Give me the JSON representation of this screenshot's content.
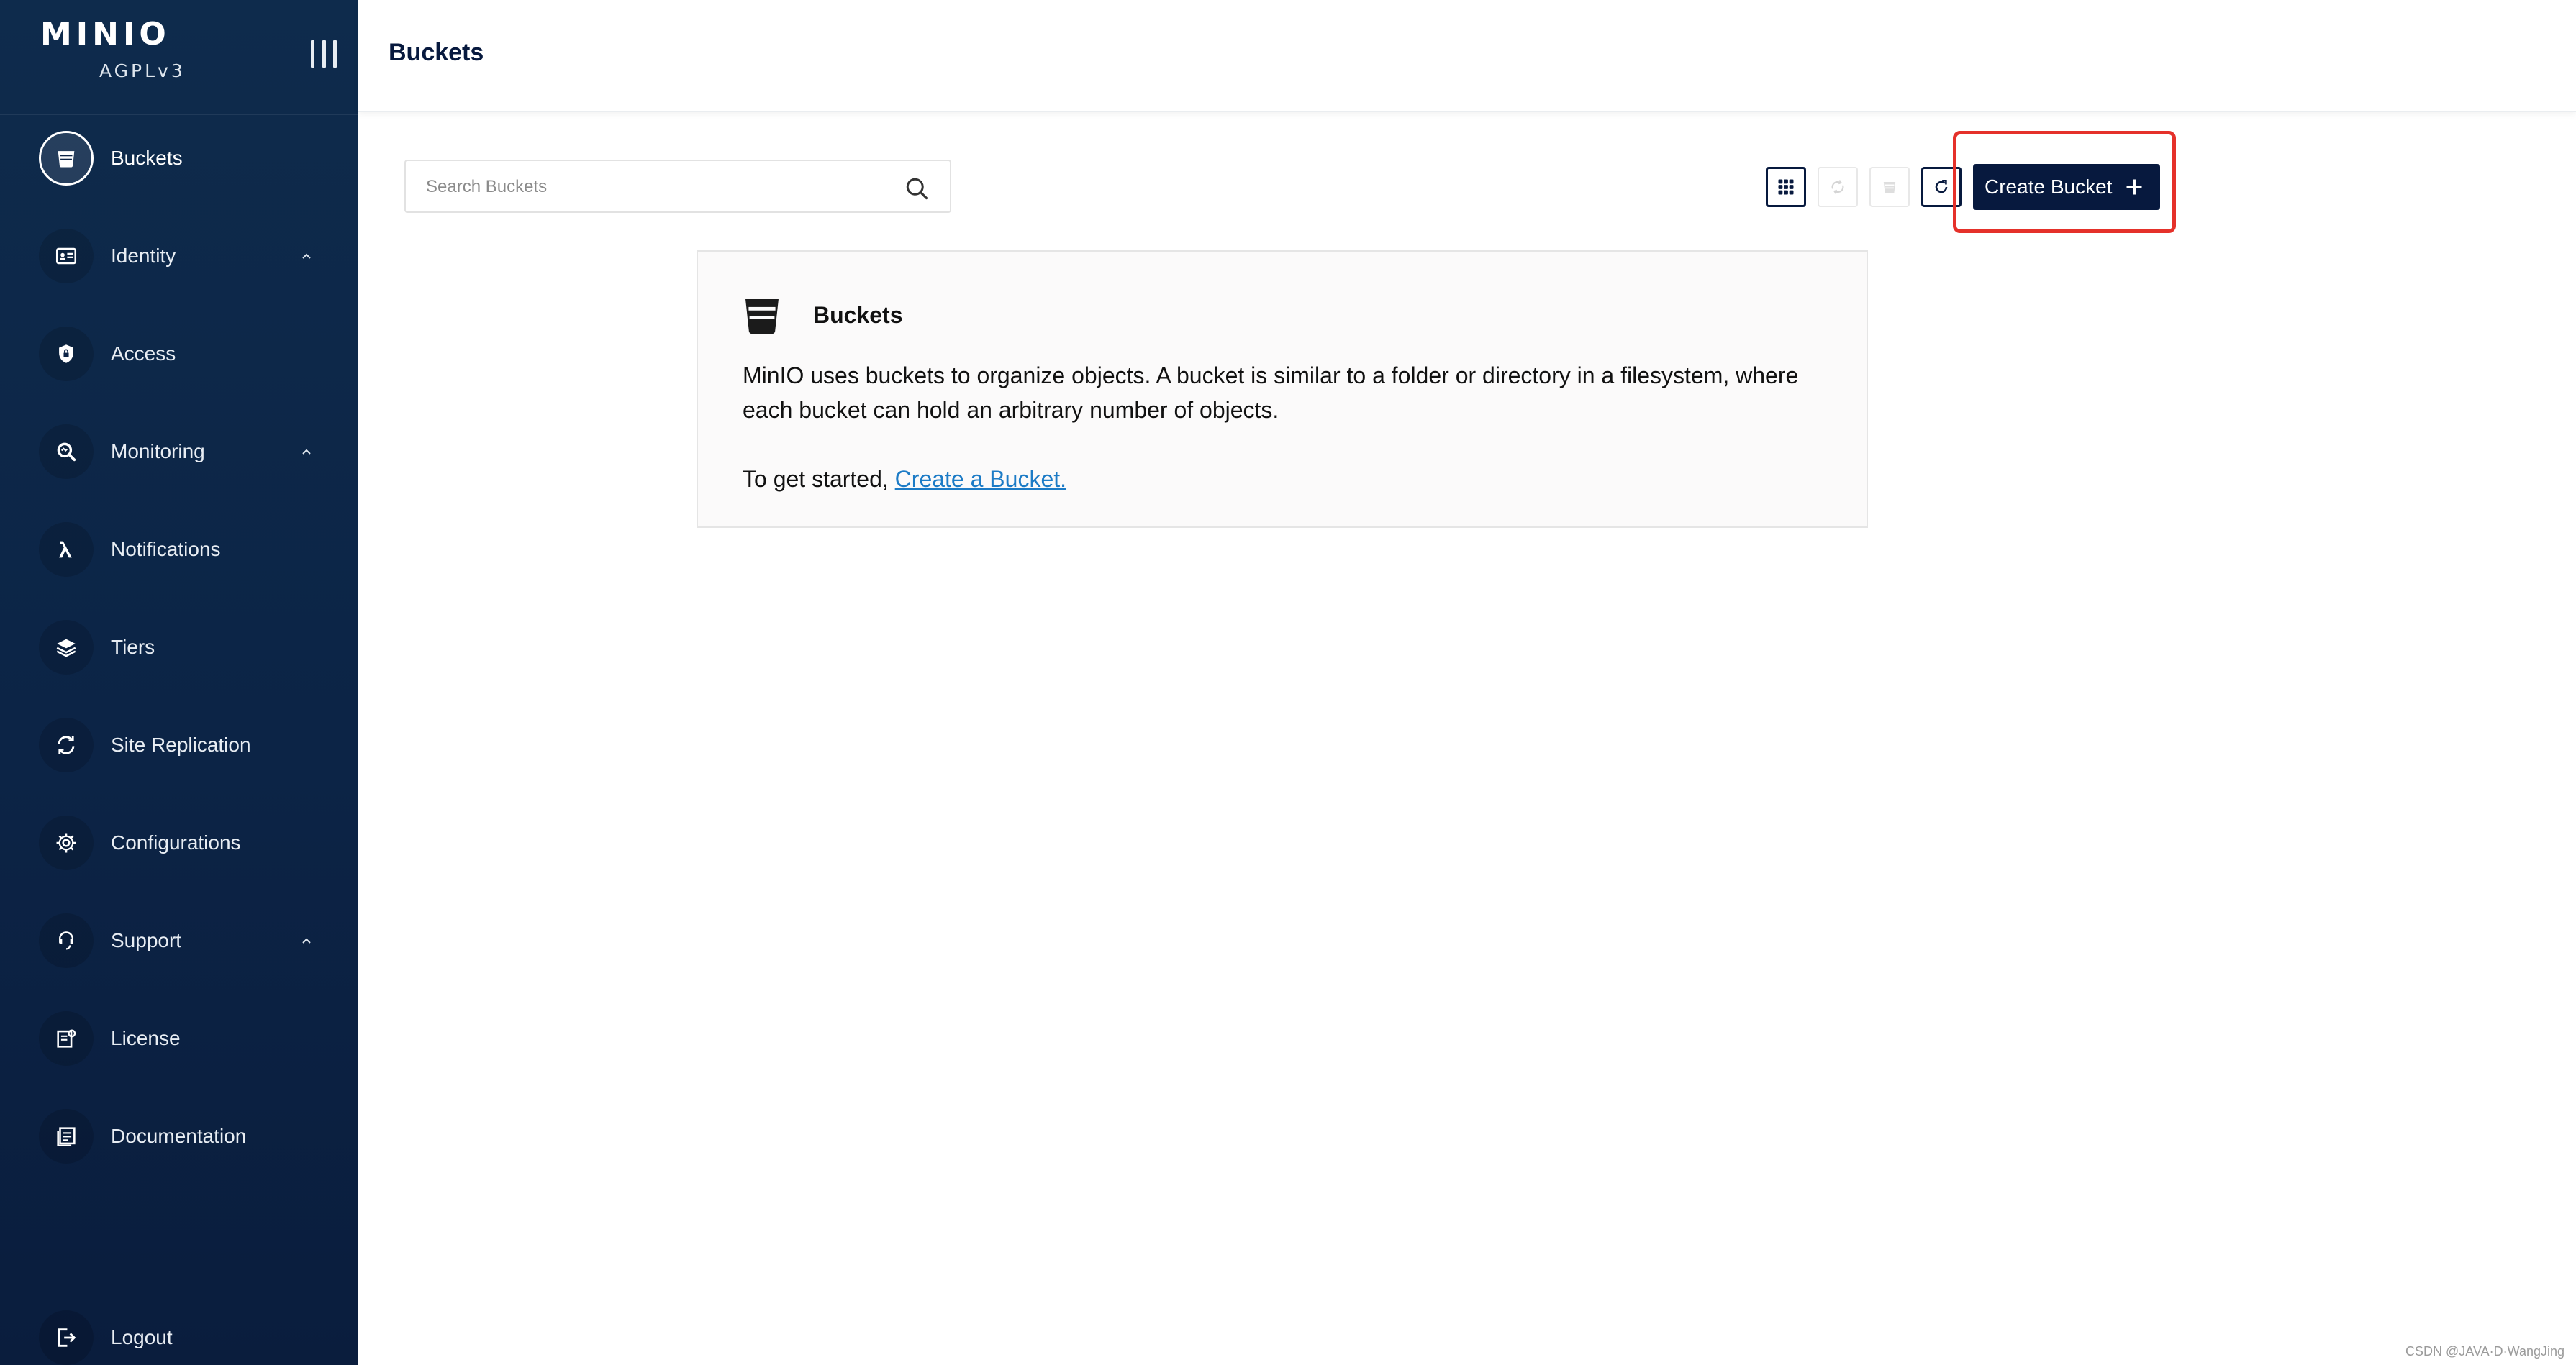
{
  "brand": {
    "logo": "MINIO",
    "edition": "AGPLv3"
  },
  "sidebar": {
    "items": [
      {
        "label": "Buckets",
        "icon": "bucket-icon",
        "active": true,
        "expandable": false
      },
      {
        "label": "Identity",
        "icon": "id-card-icon",
        "active": false,
        "expandable": true
      },
      {
        "label": "Access",
        "icon": "shield-lock-icon",
        "active": false,
        "expandable": false
      },
      {
        "label": "Monitoring",
        "icon": "magnifier-icon",
        "active": false,
        "expandable": true
      },
      {
        "label": "Notifications",
        "icon": "lambda-icon",
        "active": false,
        "expandable": false
      },
      {
        "label": "Tiers",
        "icon": "layers-icon",
        "active": false,
        "expandable": false
      },
      {
        "label": "Site Replication",
        "icon": "replication-icon",
        "active": false,
        "expandable": false
      },
      {
        "label": "Configurations",
        "icon": "gear-icon",
        "active": false,
        "expandable": false
      },
      {
        "label": "Support",
        "icon": "support-icon",
        "active": false,
        "expandable": true
      },
      {
        "label": "License",
        "icon": "license-icon",
        "active": false,
        "expandable": false
      },
      {
        "label": "Documentation",
        "icon": "documentation-icon",
        "active": false,
        "expandable": false
      }
    ],
    "logout_label": "Logout"
  },
  "header": {
    "title": "Buckets"
  },
  "toolbar": {
    "search_placeholder": "Search Buckets",
    "create_label": "Create Bucket"
  },
  "info": {
    "title": "Buckets",
    "description": "MinIO uses buckets to organize objects. A bucket is similar to a folder or directory in a filesystem, where each bucket can hold an arbitrary number of objects.",
    "start_prefix": "To get started, ",
    "start_link": "Create a Bucket."
  },
  "watermark": "CSDN @JAVA·D·WangJing",
  "colors": {
    "sidebar": "#0c2446",
    "primary": "#07193e",
    "link": "#1c7bc6",
    "highlight": "#e5312a"
  }
}
